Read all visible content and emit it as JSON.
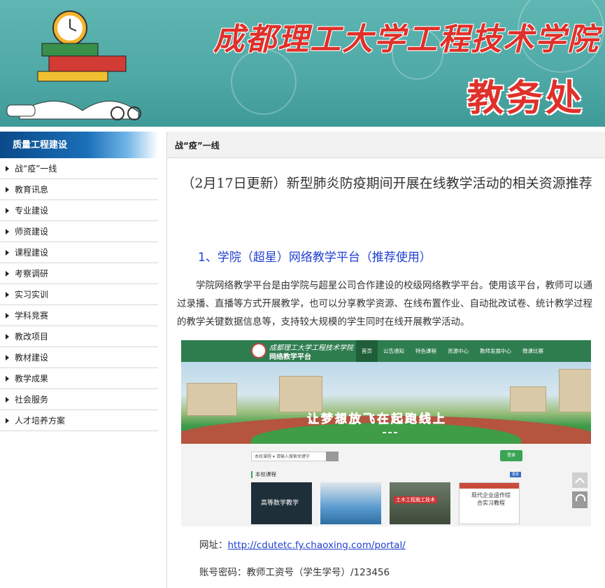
{
  "banner": {
    "school_name": "成都理工大学工程技术学院",
    "department": "教务处"
  },
  "sidebar": {
    "heading": "质量工程建设",
    "items": [
      {
        "label": "战“疫”一线"
      },
      {
        "label": "教育讯息"
      },
      {
        "label": "专业建设"
      },
      {
        "label": "师资建设"
      },
      {
        "label": "课程建设"
      },
      {
        "label": "考察调研"
      },
      {
        "label": "实习实训"
      },
      {
        "label": "学科竞赛"
      },
      {
        "label": "教改项目"
      },
      {
        "label": "教材建设"
      },
      {
        "label": "教学成果"
      },
      {
        "label": "社会服务"
      },
      {
        "label": "人才培养方案"
      }
    ]
  },
  "main": {
    "breadcrumb": "战“疫”一线",
    "title": "（2月17日更新）新型肺炎防疫期间开展在线教学活动的相关资源推荐",
    "section_heading": "1、学院（超星）网络教学平台（推荐使用）",
    "paragraph": "学院网络教学平台是由学院与超星公司合作建设的校级网络教学平台。使用该平台，教师可以通过录播、直播等方式开展教学，也可以分享教学资源、在线布置作业、自动批改试卷、统计教学过程的教学关键数据信息等，支持较大规模的学生同时在线开展教学活动。",
    "url_label": "网址：",
    "url": "http://cdutetc.fy.chaoxing.com/portal/",
    "account_text": "账号密码：教师工资号（学生学号）/123456"
  },
  "screenshot": {
    "site_title": "成都理工大学工程技术学院",
    "site_subtitle": "网络教学平台",
    "menu": [
      "首页",
      "公告通知",
      "特色课程",
      "资源中心",
      "教师发展中心",
      "微课比赛"
    ],
    "slogan": "让梦想放飞在起跑线上",
    "search_category": "本校课程",
    "search_placeholder": "请输入搜索关键字",
    "login_label": "登录",
    "section_label": "本校课程",
    "more_label": "更多",
    "thumbs": [
      "高等数学教学",
      "",
      "土木工程施工技术",
      "现代企业运作综合实习教程"
    ]
  }
}
